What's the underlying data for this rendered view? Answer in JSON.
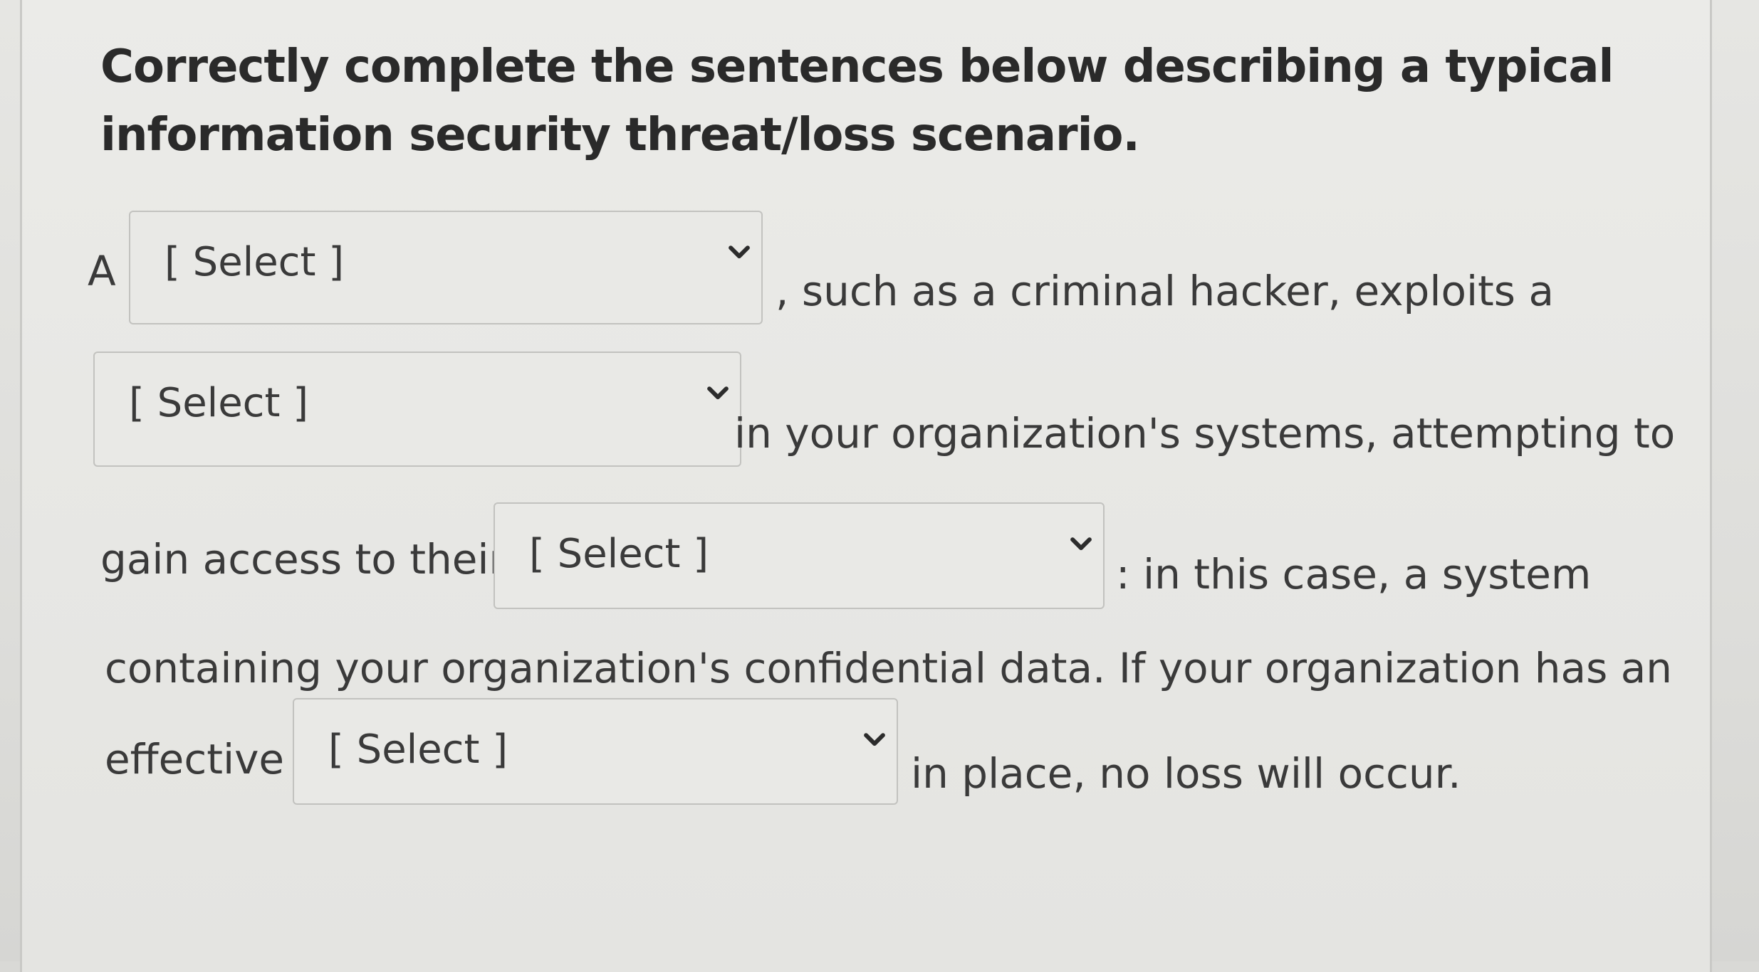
{
  "question": {
    "title": "Correctly complete the sentences below describing a typical information security threat/loss scenario."
  },
  "sentence": {
    "lead": "A",
    "after_1": ", such as a criminal hacker, exploits a",
    "after_2": "in your organization's systems, attempting to",
    "before_3": "gain access to their",
    "after_3": ": in this case, a system",
    "line_4": "containing your organization's confidential data. If your organization has an",
    "before_4": "effective",
    "after_4": "in place, no loss will occur."
  },
  "dropdowns": [
    {
      "selected": "[ Select ]",
      "icon": "chevron-down-icon"
    },
    {
      "selected": "[ Select ]",
      "icon": "chevron-down-icon"
    },
    {
      "selected": "[ Select ]",
      "icon": "chevron-down-icon"
    },
    {
      "selected": "[ Select ]",
      "icon": "chevron-down-icon"
    }
  ],
  "colors": {
    "text": "#3a3a3a",
    "title": "#2a2a2a",
    "panel": "#e8e8e5",
    "dropdown_border": "#c2c2bf"
  }
}
